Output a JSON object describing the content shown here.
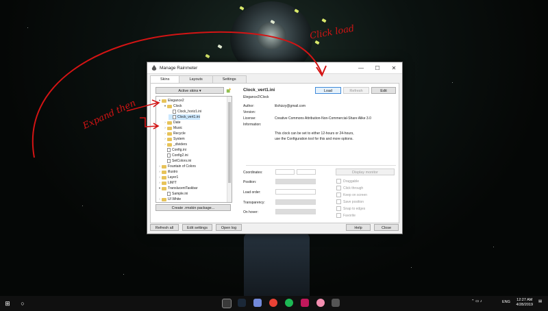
{
  "window": {
    "title": "Manage Rainmeter",
    "controls": [
      "—",
      "☐",
      "✕"
    ]
  },
  "tabs": [
    {
      "label": "Skins",
      "active": true
    },
    {
      "label": "Layouts",
      "active": false
    },
    {
      "label": "Settings",
      "active": false
    }
  ],
  "skins_panel": {
    "active_skins_label": "Active skins ▾",
    "create_package_label": "Create .rmskin package...",
    "tree": [
      {
        "label": "Elegance2",
        "type": "folder",
        "expanded": true,
        "level": 0
      },
      {
        "label": "Clock",
        "type": "folder",
        "expanded": true,
        "level": 1
      },
      {
        "label": "Clock_horiz1.ini",
        "type": "file",
        "level": 2
      },
      {
        "label": "Clock_vert1.ini",
        "type": "file",
        "level": 2,
        "selected": true
      },
      {
        "label": "Date",
        "type": "folder",
        "level": 1
      },
      {
        "label": "Music",
        "type": "folder",
        "level": 1
      },
      {
        "label": "Recycle",
        "type": "folder",
        "level": 1
      },
      {
        "label": "System",
        "type": "folder",
        "level": 1
      },
      {
        "label": "_dividers",
        "type": "folder",
        "level": 1
      },
      {
        "label": "Config.ini",
        "type": "file",
        "level": 1
      },
      {
        "label": "Config2.ini",
        "type": "file",
        "level": 1
      },
      {
        "label": "SetColors.ini",
        "type": "file",
        "level": 1
      },
      {
        "label": "Fountain of Colors",
        "type": "folder",
        "level": 0
      },
      {
        "label": "illustro",
        "type": "folder",
        "level": 0
      },
      {
        "label": "Layer1",
        "type": "folder",
        "level": 0
      },
      {
        "label": "LIM!T",
        "type": "folder",
        "level": 0
      },
      {
        "label": "TranslucentTaskbar",
        "type": "folder",
        "expanded": true,
        "level": 0
      },
      {
        "label": "Sample.ini",
        "type": "file",
        "level": 1
      },
      {
        "label": "UI White",
        "type": "folder",
        "level": 0
      }
    ]
  },
  "skin_info": {
    "name": "Clock_vert1.ini",
    "path": "Elegance2\\Clock",
    "buttons": {
      "load": "Load",
      "refresh": "Refresh",
      "edit": "Edit"
    },
    "author_label": "Author:",
    "author": "lilshizzy@gmail.com",
    "version_label": "Version:",
    "license_label": "License:",
    "license": "Creative Commons Attribution-Non-Commercial-Share Alike 3.0",
    "information_label": "Information:",
    "description_1": "This clock can be set to either 12-hours or 24-hours,",
    "description_2": "use the Configuration tool for this and more options."
  },
  "skin_settings": {
    "coordinates_label": "Coordinates:",
    "position_label": "Position:",
    "load_order_label": "Load order:",
    "transparency_label": "Transparency:",
    "on_hover_label": "On hover:",
    "display_monitor_label": "Display monitor",
    "checkboxes": [
      "Draggable",
      "Click through",
      "Keep on screen",
      "Save position",
      "Snap to edges",
      "Favorite"
    ]
  },
  "footer": {
    "refresh_all": "Refresh all",
    "edit_settings": "Edit settings",
    "open_log": "Open log",
    "help": "Help",
    "close": "Close"
  },
  "taskbar": {
    "language": "ENG",
    "time": "12:27 AM",
    "date": "4/28/2019"
  },
  "annotations": {
    "click_load": "Click load",
    "expand_then": "Expand then",
    "color": "#d41414"
  }
}
